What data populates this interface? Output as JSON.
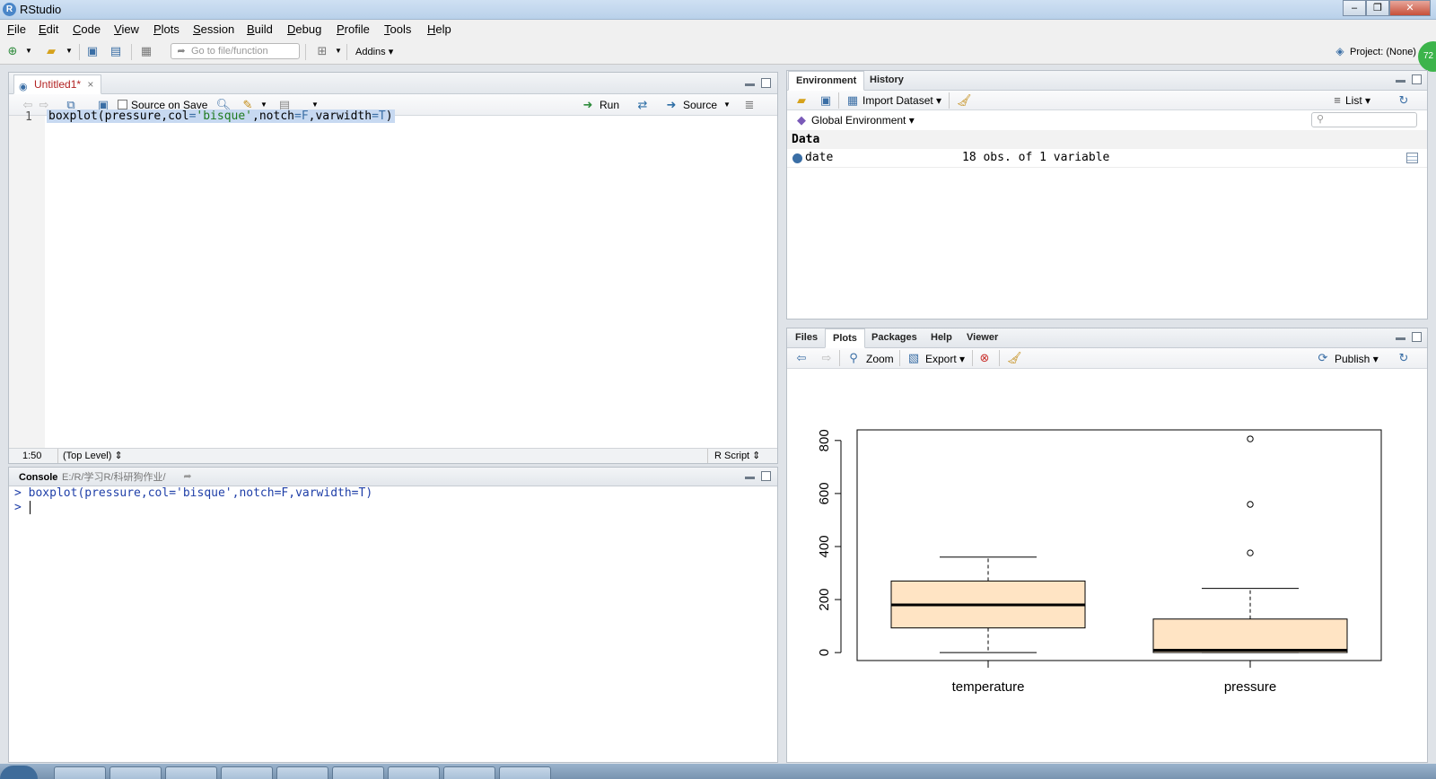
{
  "window": {
    "title": "RStudio",
    "logo": "R"
  },
  "menubar": {
    "items": [
      {
        "first": "F",
        "rest": "ile"
      },
      {
        "first": "E",
        "rest": "dit"
      },
      {
        "first": "C",
        "rest": "ode"
      },
      {
        "first": "V",
        "rest": "iew"
      },
      {
        "first": "P",
        "rest": "lots"
      },
      {
        "first": "S",
        "rest": "ession"
      },
      {
        "first": "B",
        "rest": "uild"
      },
      {
        "first": "D",
        "rest": "ebug"
      },
      {
        "first": "P",
        "rest": "rofile"
      },
      {
        "first": "T",
        "rest": "ools"
      },
      {
        "first": "H",
        "rest": "elp"
      }
    ]
  },
  "toolbar": {
    "goto_placeholder": "Go to file/function",
    "addins_label": "Addins",
    "project_label": "Project: (None)",
    "badge": "72"
  },
  "source_pane": {
    "tab_label": "Untitled1*",
    "source_on_save": "Source on Save",
    "run_label": "Run",
    "source_label": "Source",
    "line_number": "1",
    "code": {
      "fn": "boxplot",
      "open": "(",
      "arg1": "pressure",
      "comma1": ",",
      "col_key": "col",
      "eq1": "=",
      "col_val": "'bisque'",
      "comma2": ",",
      "notch_key": "notch",
      "eq2": "=",
      "notch_val": "F",
      "comma3": ",",
      "varwidth_key": "varwidth",
      "eq3": "=",
      "varwidth_val": "T",
      "close": ")"
    },
    "status_position": "1:50",
    "status_scope": "(Top Level)",
    "status_type": "R Script"
  },
  "console_pane": {
    "tab_label": "Console",
    "path": "E:/R/学习R/科研狗作业/",
    "line1_prompt": ">",
    "line1_code": "boxplot(pressure,col='bisque',notch=F,varwidth=T)",
    "line2_prompt": ">"
  },
  "env_pane": {
    "tabs": [
      "Environment",
      "History"
    ],
    "import_label": "Import Dataset",
    "list_label": "List",
    "scope_label": "Global Environment",
    "section_label": "Data",
    "rows": [
      {
        "name": "date",
        "value": "18 obs. of 1 variable"
      }
    ]
  },
  "files_pane": {
    "tabs": [
      "Files",
      "Plots",
      "Packages",
      "Help",
      "Viewer"
    ],
    "zoom_label": "Zoom",
    "export_label": "Export",
    "publish_label": "Publish"
  },
  "chart_data": {
    "type": "boxplot",
    "categories": [
      "temperature",
      "pressure"
    ],
    "ylim": [
      -30,
      840
    ],
    "yticks": [
      0,
      200,
      400,
      600,
      800
    ],
    "fill_color": "#ffe4c4",
    "boxes": [
      {
        "name": "temperature",
        "lower_whisker": 0,
        "q1": 93,
        "median": 180,
        "q3": 270,
        "upper_whisker": 360,
        "outliers": []
      },
      {
        "name": "pressure",
        "lower_whisker": 0.0002,
        "q1": 0.18,
        "median": 8.8,
        "q3": 126.5,
        "upper_whisker": 242,
        "outliers": [
          376,
          559,
          806
        ]
      }
    ]
  },
  "taskbar": {
    "items": 10
  }
}
